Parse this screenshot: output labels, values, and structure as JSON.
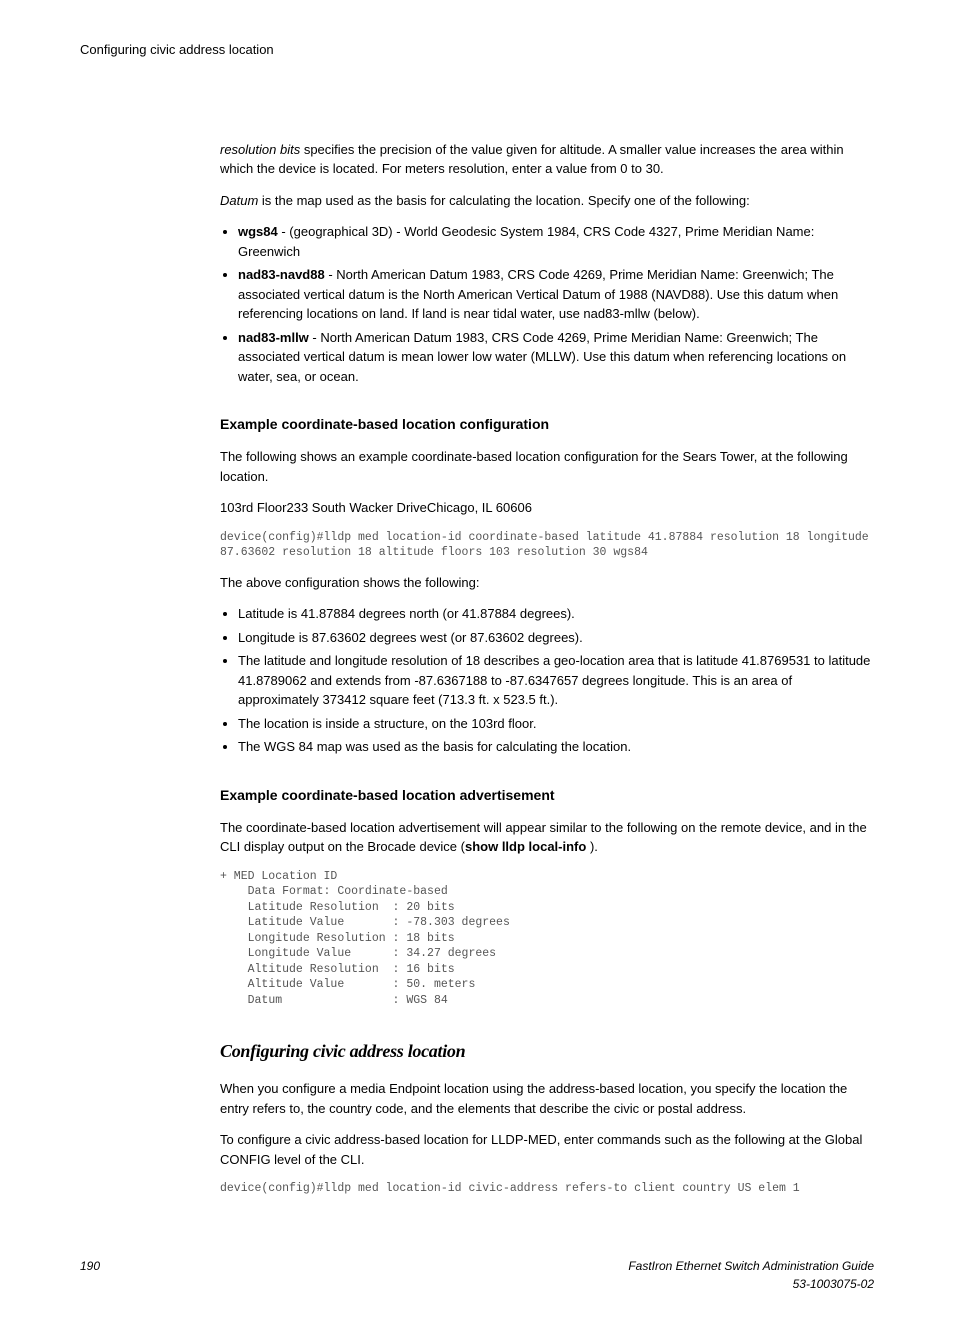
{
  "header": "Configuring civic address location",
  "para1_prefix": "resolution bits",
  "para1_rest": " specifies the precision of the value given for altitude. A smaller value increases the area within which the device is located. For meters resolution, enter a value from 0 to 30.",
  "para2_prefix": "Datum",
  "para2_rest": " is the map used as the basis for calculating the location. Specify one of the following:",
  "bullets1": [
    {
      "bold": "wgs84",
      "rest": " - (geographical 3D) - World Geodesic System 1984, CRS Code 4327, Prime Meridian Name: Greenwich"
    },
    {
      "bold": "nad83-navd88",
      "rest": " - North American Datum 1983, CRS Code 4269, Prime Meridian Name: Greenwich; The associated vertical datum is the North American Vertical Datum of 1988 (NAVD88). Use this datum when referencing locations on land. If land is near tidal water, use nad83-mllw (below)."
    },
    {
      "bold": "nad83-mllw",
      "rest": " - North American Datum 1983, CRS Code 4269, Prime Meridian Name: Greenwich; The associated vertical datum is mean lower low water (MLLW). Use this datum when referencing locations on water, sea, or ocean."
    }
  ],
  "subhead1": "Example coordinate-based location configuration",
  "para3": "The following shows an example coordinate-based location configuration for the Sears Tower, at the following location.",
  "para4": "103rd Floor233 South Wacker DriveChicago, IL 60606",
  "code1": "device(config)#lldp med location-id coordinate-based latitude 41.87884 resolution 18 longitude 87.63602 resolution 18 altitude floors 103 resolution 30 wgs84",
  "para5": "The above configuration shows the following:",
  "bullets2": [
    "Latitude is 41.87884 degrees north (or 41.87884 degrees).",
    "Longitude is 87.63602 degrees west (or 87.63602 degrees).",
    "The latitude and longitude resolution of 18 describes a geo-location area that is latitude 41.8769531 to latitude 41.8789062 and extends from -87.6367188 to -87.6347657 degrees longitude. This is an area of approximately 373412 square feet (713.3 ft. x 523.5 ft.).",
    "The location is inside a structure, on the 103rd floor.",
    "The WGS 84 map was used as the basis for calculating the location."
  ],
  "subhead2": "Example coordinate-based location advertisement",
  "para6_a": "The coordinate-based location advertisement will appear similar to the following on the remote device, and in the CLI display output on the Brocade device (",
  "para6_bold": "show lldp local-info",
  "para6_b": " ).",
  "code2": "+ MED Location ID\n    Data Format: Coordinate-based\n    Latitude Resolution  : 20 bits\n    Latitude Value       : -78.303 degrees\n    Longitude Resolution : 18 bits\n    Longitude Value      : 34.27 degrees\n    Altitude Resolution  : 16 bits\n    Altitude Value       : 50. meters\n    Datum                : WGS 84",
  "section2": "Configuring civic address location",
  "para7": "When you configure a media Endpoint location using the address-based location, you specify the location the entry refers to, the country code, and the elements that describe the civic or postal address.",
  "para8": "To configure a civic address-based location for LLDP-MED, enter commands such as the following at the Global CONFIG level of the CLI.",
  "code3": "device(config)#lldp med location-id civic-address refers-to client country US elem 1",
  "footer": {
    "page": "190",
    "title": "FastIron Ethernet Switch Administration Guide",
    "docnum": "53-1003075-02"
  }
}
